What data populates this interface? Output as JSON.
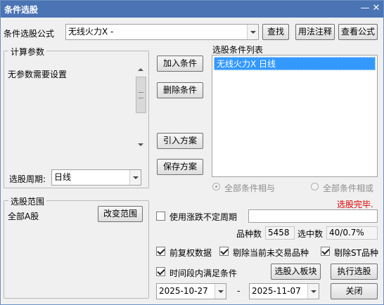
{
  "window": {
    "title": "条件选股",
    "minimize": "—",
    "close": "✕"
  },
  "formula": {
    "label": "条件选股公式",
    "value": "无线火力X  -",
    "find": "查找",
    "usage": "用法注释",
    "view": "查看公式"
  },
  "params": {
    "group_label": "计算参数",
    "text": "无参数需要设置"
  },
  "period": {
    "label": "选股周期:",
    "value": "日线"
  },
  "buttons": {
    "add": "加入条件",
    "delete": "删除条件",
    "import": "引入方案",
    "save": "保存方案",
    "change_range": "改变范围",
    "to_block": "选股入板块",
    "execute": "执行选股",
    "close": "关闭"
  },
  "conditions": {
    "label": "选股条件列表",
    "items": [
      "无线火力X  日线"
    ]
  },
  "logic": {
    "and": "全部条件相与",
    "or": "全部条件相或"
  },
  "status": {
    "text": "选股完毕.",
    "color": "#e00000"
  },
  "range": {
    "group_label": "选股范围",
    "value": "全部A股"
  },
  "uncertain_period": {
    "label": "使用涨跌不定周期",
    "value": ""
  },
  "stats": {
    "count_label": "品种数",
    "count_value": "5458",
    "selected_label": "选中数",
    "selected_value": "40/0.7%"
  },
  "options": {
    "prior_rights": "前复权数据",
    "exclude_untraded": "剔除当前未交易品种",
    "exclude_st": "剔除ST品种",
    "time_range": "时间段内满足条件"
  },
  "dates": {
    "start": "2025-10-27",
    "separator": "-",
    "end": "2025-11-07"
  }
}
